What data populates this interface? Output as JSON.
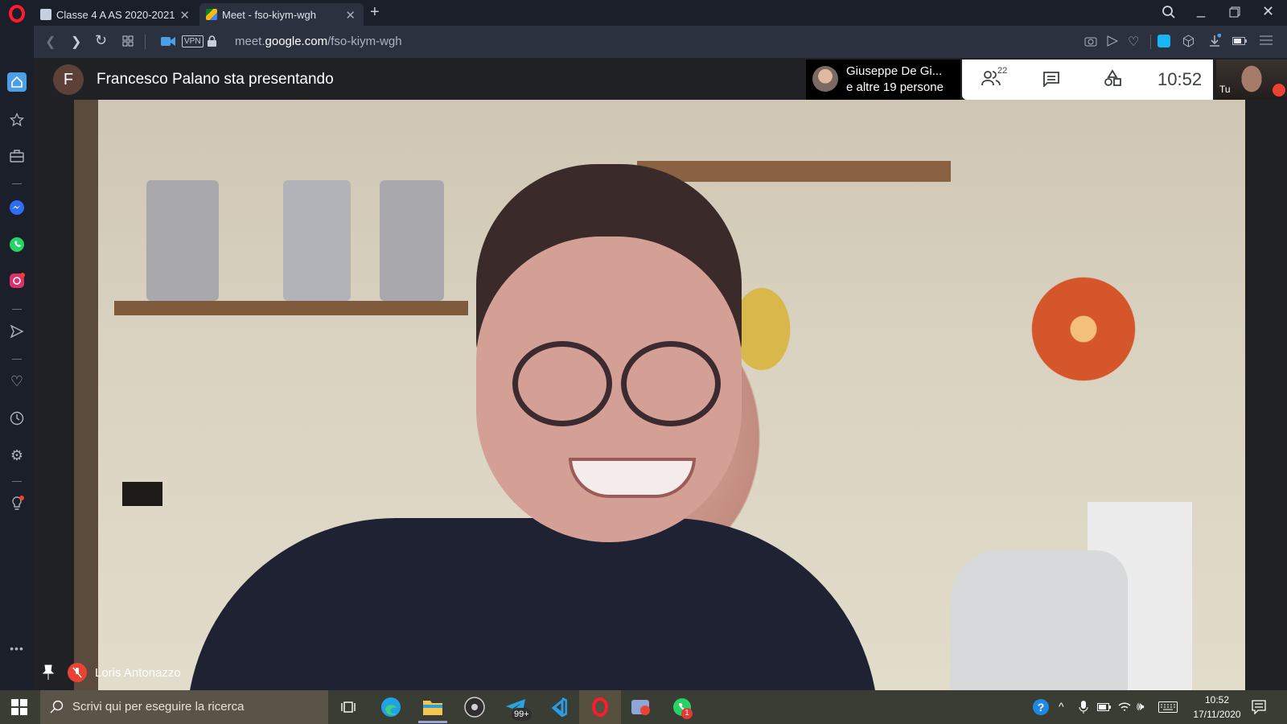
{
  "browser": {
    "tabs": [
      {
        "label": "Classe 4 A AS 2020-2021",
        "active": false
      },
      {
        "label": "Meet - fso-kiym-wgh",
        "active": true
      }
    ],
    "new_tab": "+",
    "url_prefix": "meet.",
    "url_domain": "google.com",
    "url_path": "/fso-kiym-wgh",
    "vpn_label": "VPN"
  },
  "meet": {
    "presenter_initial": "F",
    "presenting_text": "Francesco Palano sta presentando",
    "participants_line1": "Giuseppe De Gi...",
    "participants_line2": "e altre 19 persone",
    "people_count": "22",
    "clock": "10:52",
    "self_label": "Tu",
    "speaker_name": "Loris Antonazzo"
  },
  "taskbar": {
    "search_placeholder": "Scrivi qui per eseguire la ricerca",
    "telegram_badge": "99+",
    "whatsapp_badge": "1",
    "time": "10:52",
    "date": "17/11/2020"
  },
  "colors": {
    "opera_red": "#ff1b2d",
    "meet_bg": "#202124",
    "mic_off_red": "#ea4335",
    "taskbar": "#3a3d33"
  }
}
